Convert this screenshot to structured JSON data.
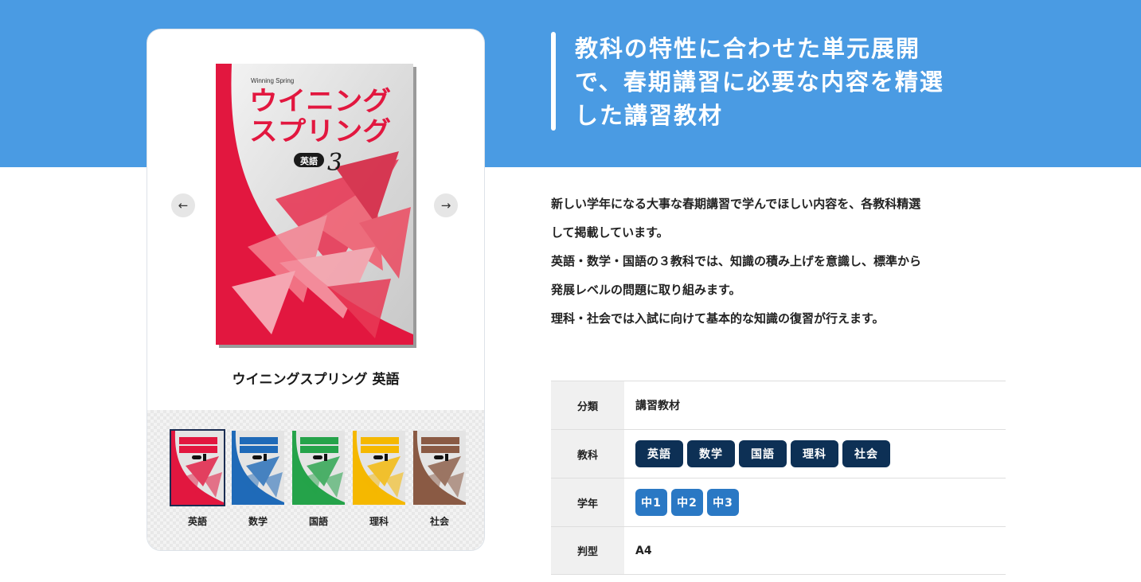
{
  "headline": {
    "line1": "教科の特性に合わせた単元展開",
    "line2": "で、春期講習に必要な内容を精選",
    "line3": "した講習教材"
  },
  "description": [
    "新しい学年になる大事な春期講習で学んでほしい内容を、各教科精選",
    "して掲載しています。",
    "英語・数学・国語の３教科では、知識の積み上げを意識し、標準から",
    "発展レベルの問題に取り組みます。",
    "理科・社会では入試に向けて基本的な知識の復習が行えます。"
  ],
  "product": {
    "title": "ウイニングスプリング 英語",
    "cover": {
      "series_en": "Winning Spring",
      "title_line1": "ウイニング",
      "title_line2": "スプリング",
      "subject_badge": "英語",
      "grade_number": "3"
    }
  },
  "carousel": {
    "prev_icon": "arrow-left-icon",
    "next_icon": "arrow-right-icon"
  },
  "thumbnails": [
    {
      "label": "英語",
      "color": "#e2173f",
      "selected": true
    },
    {
      "label": "数学",
      "color": "#1f6ab8"
    },
    {
      "label": "国語",
      "color": "#25a34a"
    },
    {
      "label": "理科",
      "color": "#f5b800"
    },
    {
      "label": "社会",
      "color": "#8a5a44"
    }
  ],
  "specs": {
    "category": {
      "label": "分類",
      "value": "講習教材"
    },
    "subjects": {
      "label": "教科",
      "chips": [
        "英語",
        "数学",
        "国語",
        "理科",
        "社会"
      ]
    },
    "grades": {
      "label": "学年",
      "chips": [
        "中1",
        "中2",
        "中3"
      ]
    },
    "format": {
      "label": "判型",
      "value": "A4"
    }
  },
  "colors": {
    "banner": "#4a9be3",
    "subject_chip": "#0d3055",
    "grade_chip": "#2a78c4",
    "cover_red": "#e2173f"
  }
}
